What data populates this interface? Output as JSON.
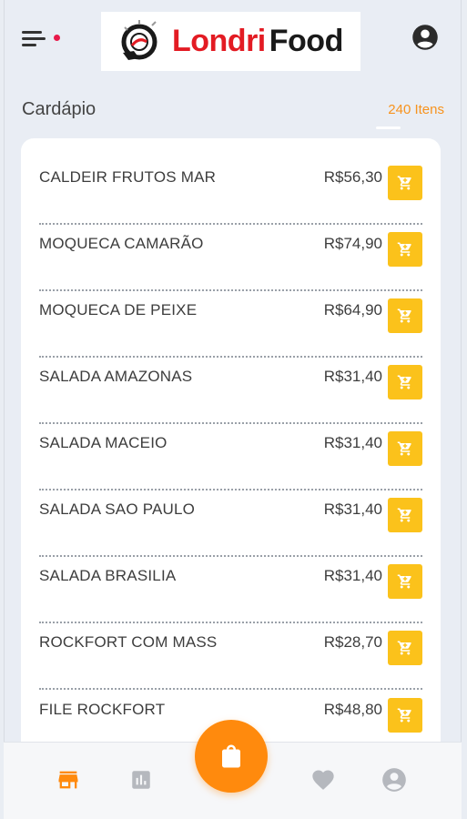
{
  "header": {
    "menu_icon": "menu-icon",
    "logo": {
      "word1": "Londri",
      "word2": "Food"
    },
    "account_icon": "account-circle-icon"
  },
  "menu_section": {
    "title": "Cardápio",
    "count": "240 Itens"
  },
  "items": [
    {
      "name": "CALDEIR FRUTOS MAR",
      "price": "R$56,30"
    },
    {
      "name": "MOQUECA CAMARÃO",
      "price": "R$74,90"
    },
    {
      "name": "MOQUECA DE PEIXE",
      "price": "R$64,90"
    },
    {
      "name": "SALADA AMAZONAS",
      "price": "R$31,40"
    },
    {
      "name": "SALADA MACEIO",
      "price": "R$31,40"
    },
    {
      "name": "SALADA SAO PAULO",
      "price": "R$31,40"
    },
    {
      "name": "SALADA BRASILIA",
      "price": "R$31,40"
    },
    {
      "name": "ROCKFORT COM MASS",
      "price": "R$28,70"
    },
    {
      "name": "FILE ROCKFORT",
      "price": "R$48,80"
    }
  ],
  "bottom_nav": {
    "items": [
      "store-icon",
      "chart-icon",
      "heart-icon",
      "account-icon"
    ],
    "fab_icon": "shopping-bag-icon",
    "active": "store-icon"
  },
  "colors": {
    "accent": "#ff8a0d",
    "cart_button": "#fbc21b",
    "brand_red": "#e31b23",
    "count_text": "#f7931e"
  }
}
